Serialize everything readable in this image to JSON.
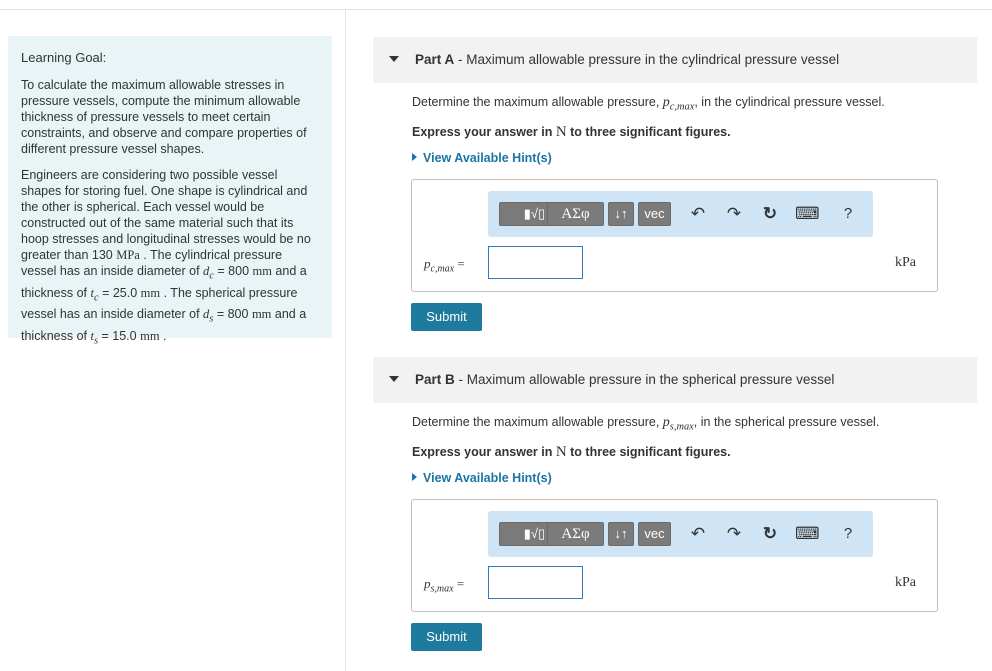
{
  "goal": {
    "title": "Learning Goal:",
    "p1": "To calculate the maximum allowable stresses in pressure vessels, compute the minimum allowable thickness of pressure vessels to meet certain constraints, and observe and compare properties of different pressure vessel shapes.",
    "p2a": "Engineers are considering two possible vessel shapes for storing fuel. One shape is cylindrical and the other is spherical. Each vessel would be constructed out of the same material such that its hoop stresses and longitudinal stresses would be no greater than 130 ",
    "p2_unit_stress": "MPa",
    "p2b": " . The cylindrical pressure vessel has an inside diameter of ",
    "dc_sym": "d",
    "dc_sub": "c",
    "dc_val": " = 800 ",
    "mm1": "mm",
    "p2c": " and a thickness of ",
    "tc_sym": "t",
    "tc_sub": "c",
    "tc_val": " = 25.0 ",
    "mm2": "mm",
    "p2d": " . The spherical pressure vessel has an inside diameter of ",
    "ds_sym": "d",
    "ds_sub": "s",
    "ds_val": " = 800 ",
    "mm3": "mm",
    "p2e": " and a thickness of ",
    "ts_sym": "t",
    "ts_sub": "s",
    "ts_val": " = 15.0 ",
    "mm4": "mm",
    "p2f": " ."
  },
  "partA": {
    "part": "Part A",
    "title": " - Maximum allowable pressure in the cylindrical pressure vessel",
    "question_pre": "Determine the maximum allowable pressure, ",
    "sym": "p",
    "sub": "c,max",
    "question_post": ", in the cylindrical pressure vessel.",
    "express_pre": "Express your answer in ",
    "express_unit": "N",
    "express_post": " to three significant figures.",
    "hint": "View Available Hint(s)",
    "label_sym": "p",
    "label_sub": "c,max",
    "label_eq": " =",
    "unit": "kPa",
    "submit": "Submit"
  },
  "partB": {
    "part": "Part B",
    "title": " - Maximum allowable pressure in the spherical pressure vessel",
    "question_pre": "Determine the maximum allowable pressure, ",
    "sym": "p",
    "sub": "s,max",
    "question_post": ", in the spherical pressure vessel.",
    "express_pre": "Express your answer in ",
    "express_unit": "N",
    "express_post": " to three significant figures.",
    "hint": "View Available Hint(s)",
    "label_sym": "p",
    "label_sub": "s,max",
    "label_eq": " =",
    "unit": "kPa",
    "submit": "Submit"
  },
  "toolbar": {
    "templates": "▮√▯",
    "greek": "ΑΣφ",
    "arrows": "↓↑",
    "vec": "vec",
    "undo": "↶",
    "redo": "↷",
    "reset": "↻",
    "keyboard": "⌨",
    "help": "?"
  }
}
